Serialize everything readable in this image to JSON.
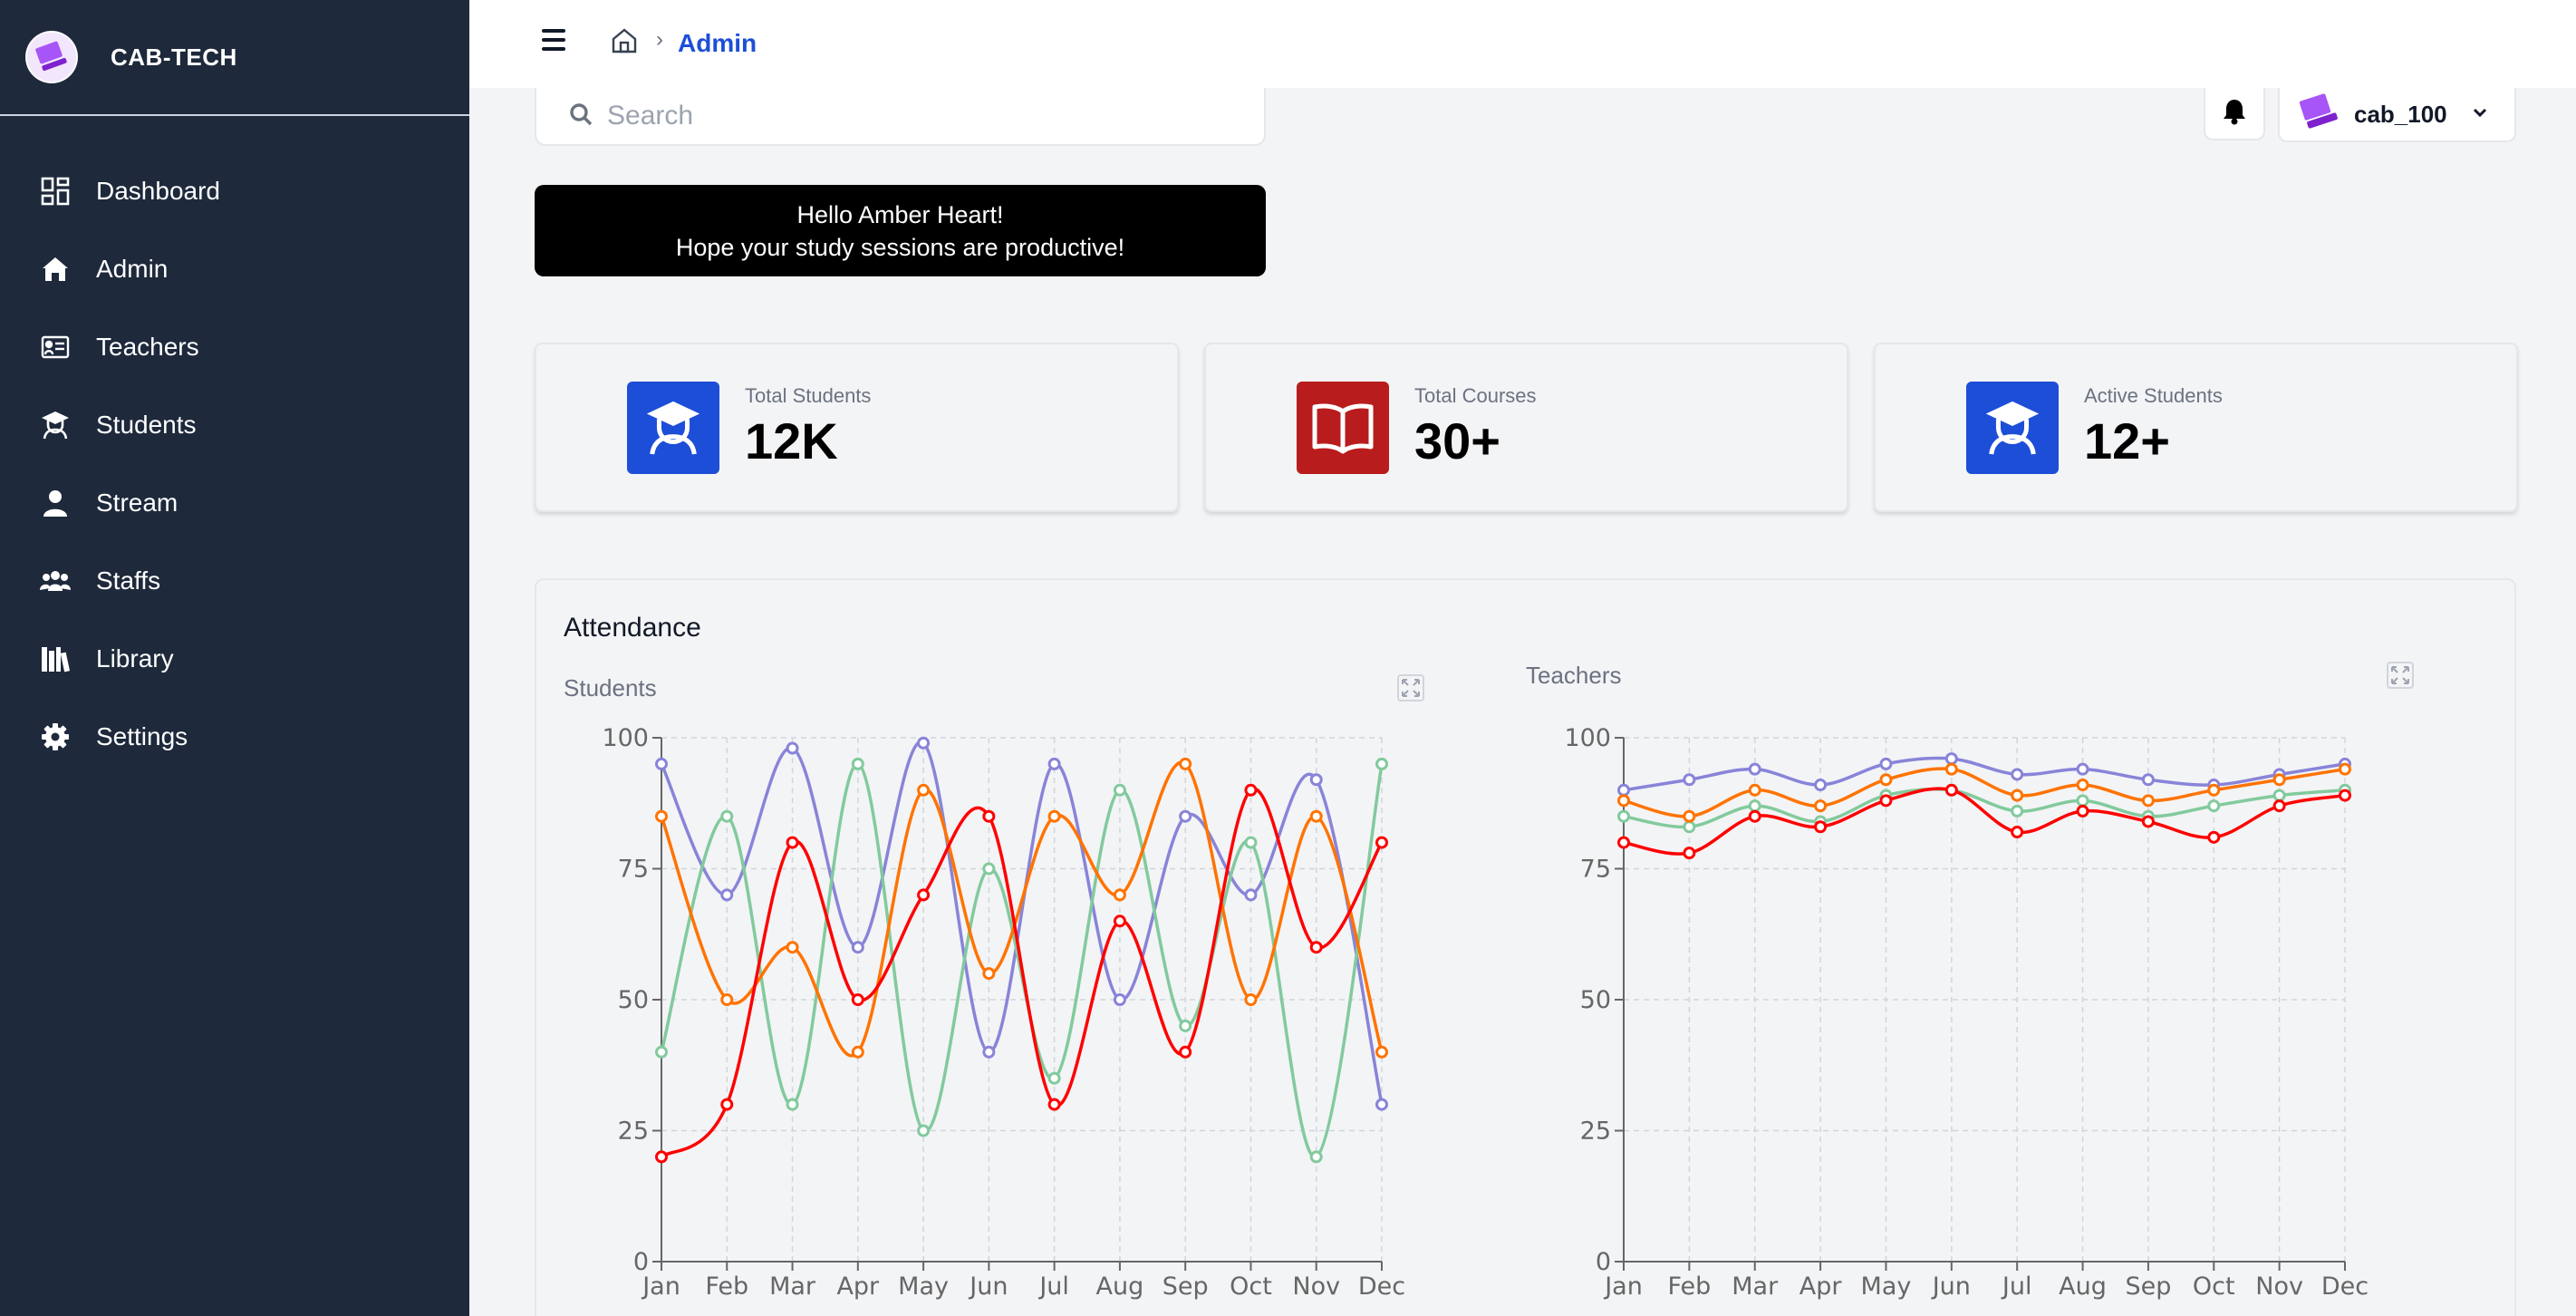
{
  "brand": {
    "name": "CAB-TECH"
  },
  "sidebar": {
    "items": [
      {
        "label": "Dashboard",
        "icon": "dashboard-icon"
      },
      {
        "label": "Admin",
        "icon": "home-icon"
      },
      {
        "label": "Teachers",
        "icon": "teacher-board-icon"
      },
      {
        "label": "Students",
        "icon": "student-icon"
      },
      {
        "label": "Stream",
        "icon": "user-icon"
      },
      {
        "label": "Staffs",
        "icon": "users-group-icon"
      },
      {
        "label": "Library",
        "icon": "library-icon"
      },
      {
        "label": "Settings",
        "icon": "gear-icon"
      }
    ]
  },
  "header": {
    "breadcrumb_current": "Admin"
  },
  "search": {
    "placeholder": "Search"
  },
  "user": {
    "name": "cab_100"
  },
  "greeting": {
    "line1": "Hello Amber Heart!",
    "line2": "Hope your study sessions are productive!"
  },
  "stats": [
    {
      "caption": "Total Students",
      "value": "12K",
      "icon": "graduate-icon",
      "color": "#1d4ed8"
    },
    {
      "caption": "Total Courses",
      "value": "30+",
      "icon": "open-book-icon",
      "color": "#b91c1c"
    },
    {
      "caption": "Active Students",
      "value": "12+",
      "icon": "graduate-icon",
      "color": "#1d4ed8"
    }
  ],
  "attendance": {
    "title": "Attendance"
  },
  "chart_data": [
    {
      "type": "line",
      "title": "Students",
      "categories": [
        "Jan",
        "Feb",
        "Mar",
        "Apr",
        "May",
        "Jun",
        "Jul",
        "Aug",
        "Sep",
        "Oct",
        "Nov",
        "Dec"
      ],
      "ylim": [
        0,
        100
      ],
      "yticks": [
        0,
        25,
        50,
        75,
        100
      ],
      "grid": true,
      "series": [
        {
          "color": "#8884d8",
          "values": [
            95,
            70,
            98,
            60,
            99,
            40,
            95,
            50,
            85,
            70,
            92,
            30
          ]
        },
        {
          "color": "#82ca9d",
          "values": [
            40,
            85,
            30,
            95,
            25,
            75,
            35,
            90,
            45,
            80,
            20,
            95
          ]
        },
        {
          "color": "#ff7300",
          "values": [
            85,
            50,
            60,
            40,
            90,
            55,
            85,
            70,
            95,
            50,
            85,
            40
          ]
        },
        {
          "color": "#ff0000",
          "values": [
            20,
            30,
            80,
            50,
            70,
            85,
            30,
            65,
            40,
            90,
            60,
            80
          ]
        }
      ]
    },
    {
      "type": "line",
      "title": "Teachers",
      "categories": [
        "Jan",
        "Feb",
        "Mar",
        "Apr",
        "May",
        "Jun",
        "Jul",
        "Aug",
        "Sep",
        "Oct",
        "Nov",
        "Dec"
      ],
      "ylim": [
        0,
        100
      ],
      "yticks": [
        0,
        25,
        50,
        75,
        100
      ],
      "grid": true,
      "series": [
        {
          "color": "#8884d8",
          "values": [
            90,
            92,
            94,
            91,
            95,
            96,
            93,
            94,
            92,
            91,
            93,
            95
          ]
        },
        {
          "color": "#82ca9d",
          "values": [
            85,
            83,
            87,
            84,
            89,
            90,
            86,
            88,
            85,
            87,
            89,
            90
          ]
        },
        {
          "color": "#ff7300",
          "values": [
            88,
            85,
            90,
            87,
            92,
            94,
            89,
            91,
            88,
            90,
            92,
            94
          ]
        },
        {
          "color": "#ff0000",
          "values": [
            80,
            78,
            85,
            83,
            88,
            90,
            82,
            86,
            84,
            81,
            87,
            89
          ]
        }
      ]
    }
  ]
}
